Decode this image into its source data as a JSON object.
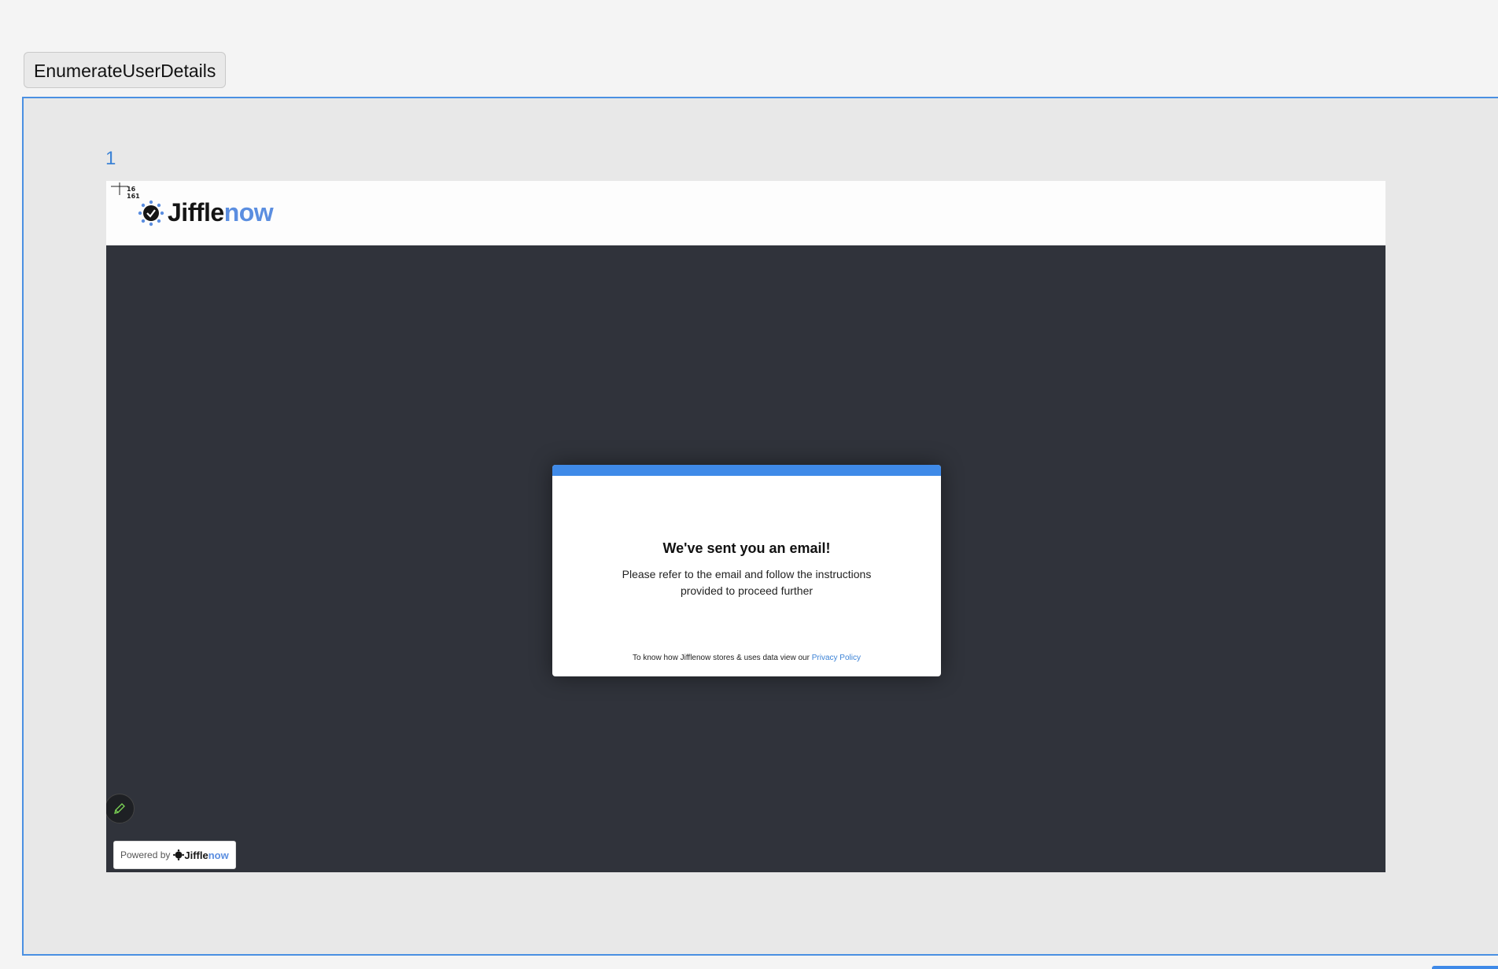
{
  "toolbar": {
    "tab_label": "EnumerateUserDetails"
  },
  "viewer": {
    "page_index": "1"
  },
  "screenshot": {
    "readout_line1": "16",
    "readout_line2": "161",
    "logo_part1": "Jiffle",
    "logo_part2": "now",
    "modal": {
      "title": "We've sent you an email!",
      "body": "Please refer to the email and follow the instructions provided to proceed further",
      "footer_text": "To know how Jifflenow stores & uses data view our ",
      "footer_link": "Privacy Policy"
    },
    "powered_by": "Powered by",
    "powered_logo_part1": "Jiffle",
    "powered_logo_part2": "now"
  },
  "colors": {
    "accent": "#3f8ae8",
    "brand_blue": "#5b8ee0",
    "dark_bg": "#30333b"
  },
  "icons": [
    "gear-clock-logo-icon",
    "pencil-icon",
    "crosshair-icon"
  ]
}
